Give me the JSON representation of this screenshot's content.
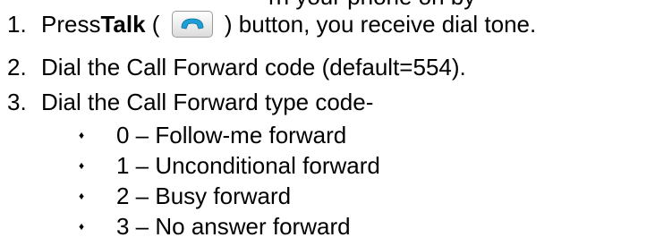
{
  "top_fragment": "rn your phone on by",
  "steps": [
    {
      "num": "1.",
      "pre": "Press ",
      "bold": "Talk",
      "open_paren": " ( ",
      "close_paren": " ) button, you receive dial tone.",
      "icon": "phone-handset-icon"
    },
    {
      "num": "2.",
      "text": "Dial the Call Forward code (default=554)."
    },
    {
      "num": "3.",
      "text": "Dial the Call Forward type code-"
    }
  ],
  "bullet_char": "♦",
  "bullets": [
    "0 – Follow-me forward",
    "1 – Unconditional forward",
    "2 – Busy forward",
    "3 – No answer forward"
  ],
  "colors": {
    "icon_handset": "#1a9fd6",
    "text": "#000000"
  }
}
